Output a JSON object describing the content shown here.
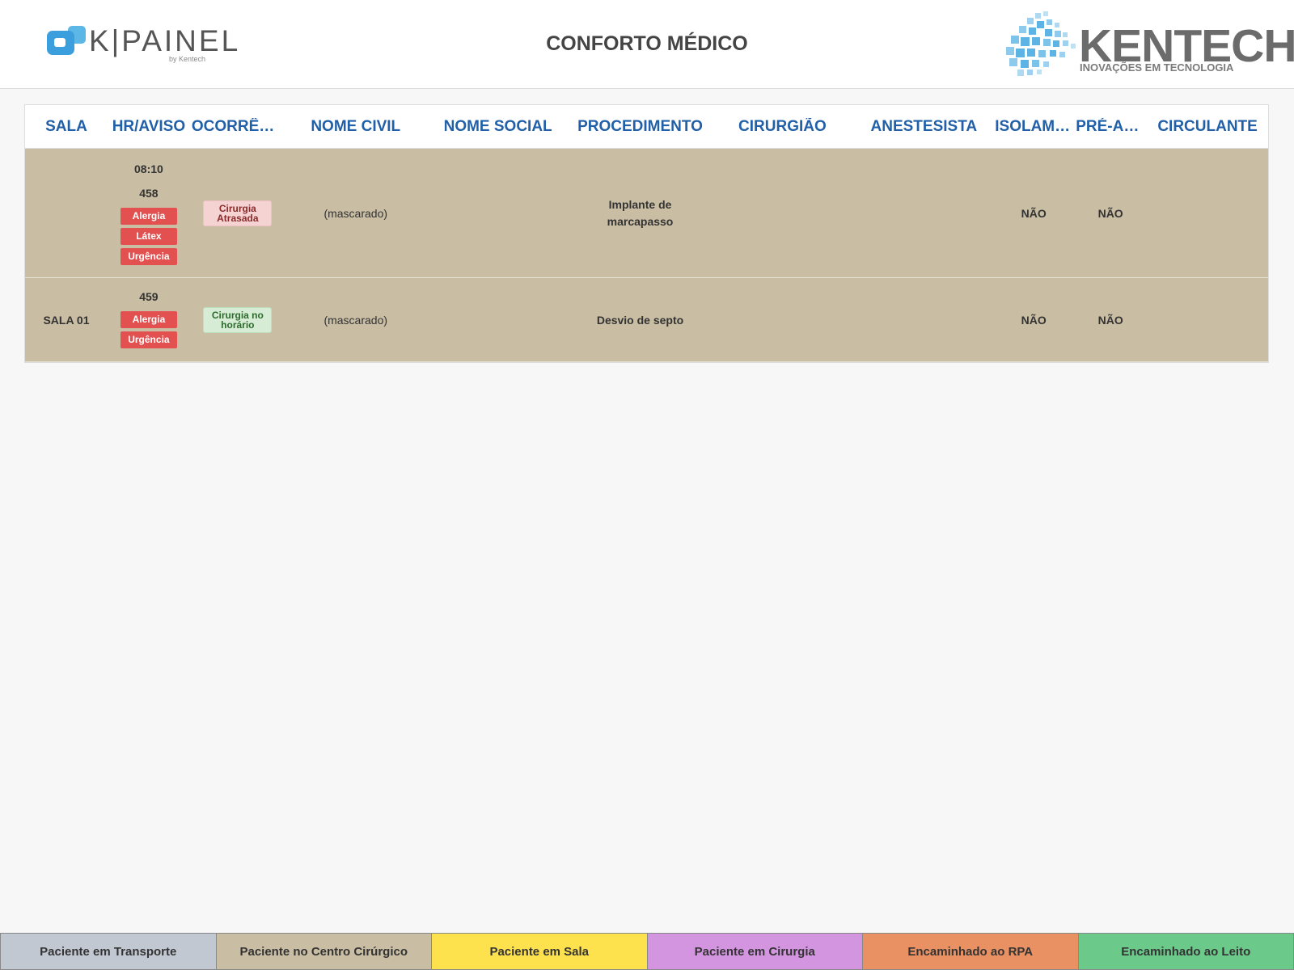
{
  "header": {
    "left_logo_text": "K|PAINEL",
    "left_logo_by": "by Kentech",
    "title": "CONFORTO MÉDICO",
    "right_logo_text": "KENTECH",
    "right_logo_sub": "INOVAÇÕES EM TECNOLOGIA"
  },
  "table": {
    "columns": [
      "SALA",
      "HR/AVISO",
      "OCORRÊNCI...",
      "NOME CIVIL",
      "NOME SOCIAL",
      "PROCEDIMENTO",
      "CIRURGIÃO",
      "ANESTESISTA",
      "ISOLAME...",
      "PRÉ-ANE.",
      "CIRCULANTE"
    ],
    "rows": [
      {
        "sala": "",
        "hora": "08:10",
        "aviso": "458",
        "tags": [
          "Alergia",
          "Látex",
          "Urgência"
        ],
        "ocorrencia": "Cirurgia Atrasada",
        "nome_civil": "(mascarado)",
        "nome_social": "",
        "procedimento": "Implante de marcapasso",
        "cirurgiao": "",
        "anestesista": "",
        "isolamento": "NÃO",
        "pre_anestesia": "NÃO",
        "circulante": ""
      },
      {
        "sala": "SALA 01",
        "hora": "",
        "aviso": "459",
        "tags": [
          "Alergia",
          "Urgência"
        ],
        "ocorrencia": "Cirurgia no horário",
        "nome_civil": "(mascarado)",
        "nome_social": "",
        "procedimento": "Desvio de septo",
        "cirurgiao": "",
        "anestesista": "",
        "isolamento": "NÃO",
        "pre_anestesia": "NÃO",
        "circulante": ""
      }
    ]
  },
  "legend": [
    {
      "label": "Paciente em Transporte",
      "color": "#c2c8d2"
    },
    {
      "label": "Paciente no Centro Cirúrgico",
      "color": "#c9bda3"
    },
    {
      "label": "Paciente em Sala",
      "color": "#fde14d"
    },
    {
      "label": "Paciente em Cirurgia",
      "color": "#d394e0"
    },
    {
      "label": "Encaminhado ao RPA",
      "color": "#e99163"
    },
    {
      "label": "Encaminhado ao Leito",
      "color": "#6bc98a"
    }
  ]
}
